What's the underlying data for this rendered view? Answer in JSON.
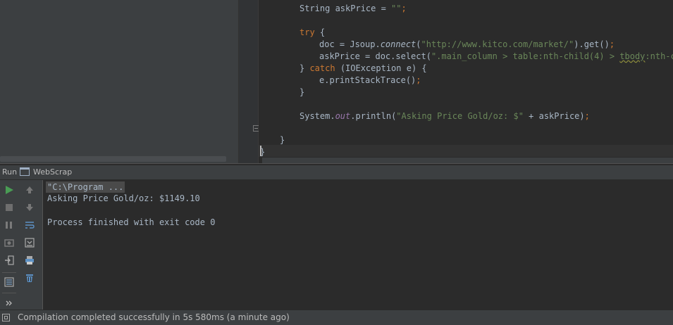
{
  "editor": {
    "lines": [
      {
        "parts": [
          {
            "t": "String askPrice = ",
            "c": ""
          },
          {
            "t": "\"\"",
            "c": "str"
          },
          {
            "t": ";",
            "c": "kw"
          }
        ]
      },
      {
        "parts": []
      },
      {
        "parts": [
          {
            "t": "try ",
            "c": "kw"
          },
          {
            "t": "{",
            "c": ""
          }
        ]
      },
      {
        "parts": [
          {
            "t": "doc = Jsoup.",
            "c": ""
          },
          {
            "t": "connect",
            "c": "fn-i"
          },
          {
            "t": "(",
            "c": ""
          },
          {
            "t": "\"http://www.kitco.com/market/\"",
            "c": "str"
          },
          {
            "t": ").get()",
            "c": ""
          },
          {
            "t": ";",
            "c": "kw"
          }
        ]
      },
      {
        "parts": [
          {
            "t": "askPrice = doc.select(",
            "c": ""
          },
          {
            "t": "\".main_column > table:nth-child(4) > ",
            "c": "str"
          },
          {
            "t": "tbody",
            "c": "str squig"
          },
          {
            "t": ":nth-chi",
            "c": "str"
          }
        ]
      },
      {
        "parts": [
          {
            "t": "} ",
            "c": ""
          },
          {
            "t": "catch ",
            "c": "kw"
          },
          {
            "t": "(IOException e) {",
            "c": ""
          }
        ]
      },
      {
        "parts": [
          {
            "t": "e.printStackTrace()",
            "c": ""
          },
          {
            "t": ";",
            "c": "kw"
          }
        ]
      },
      {
        "parts": [
          {
            "t": "}",
            "c": ""
          }
        ]
      },
      {
        "parts": []
      },
      {
        "parts": [
          {
            "t": "System.",
            "c": ""
          },
          {
            "t": "out",
            "c": "fld"
          },
          {
            "t": ".println(",
            "c": ""
          },
          {
            "t": "\"Asking Price Gold/oz: $\"",
            "c": "str"
          },
          {
            "t": " + askPrice)",
            "c": ""
          },
          {
            "t": ";",
            "c": "kw"
          }
        ]
      },
      {
        "parts": []
      },
      {
        "parts": [
          {
            "t": "}",
            "c": ""
          }
        ]
      },
      {
        "parts": [
          {
            "t": "}",
            "c": ""
          }
        ]
      }
    ]
  },
  "run_panel": {
    "label": "Run",
    "tab_label": "WebScrap"
  },
  "console": {
    "command": "\"C:\\Program ...",
    "output_lines": [
      "Asking Price Gold/oz: $1149.10",
      "",
      "Process finished with exit code 0"
    ]
  },
  "status_bar": {
    "text": "Compilation completed successfully in 5s 580ms (a minute ago)"
  },
  "colors": {
    "run_green": "#499c54",
    "toolbar_blue": "#5c91c5"
  },
  "icons": {
    "toolbar_left": [
      "run-icon",
      "stop-icon",
      "pause-icon",
      "dump-threads-icon",
      "restore-layout-icon",
      "settings-icon",
      "more-icon"
    ],
    "toolbar_right": [
      "up-arrow-icon",
      "down-arrow-icon",
      "soft-wrap-icon",
      "scroll-to-end-icon",
      "print-icon",
      "clear-all-icon"
    ]
  }
}
